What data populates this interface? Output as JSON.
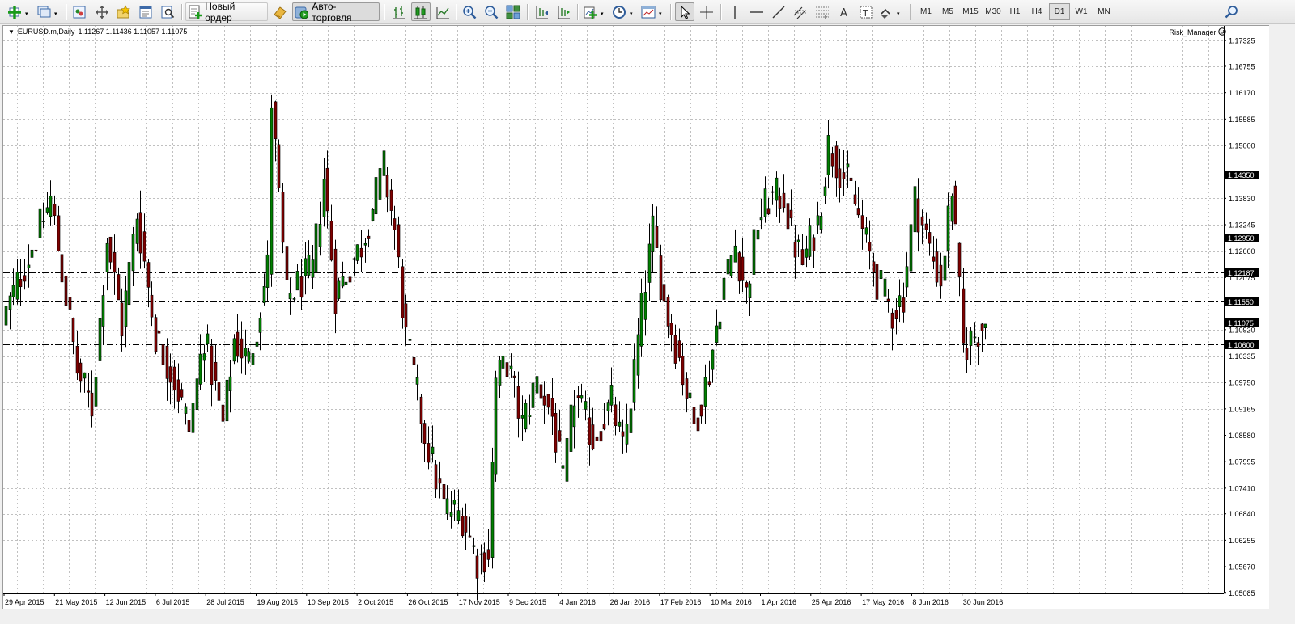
{
  "toolbar": {
    "new_order_label": "Новый ордер",
    "autotrading_label": "Авто-торговля",
    "timeframes": [
      "M1",
      "M5",
      "M15",
      "M30",
      "H1",
      "H4",
      "D1",
      "W1",
      "MN"
    ],
    "active_timeframe": "D1",
    "icons": [
      "new-chart-icon",
      "profiles-icon",
      "market-watch-icon",
      "navigator-icon",
      "favorites-icon",
      "data-window-icon",
      "strategy-tester-icon",
      "new-order-icon",
      "metaeditor-icon",
      "autotrading-icon",
      "bar-chart-icon",
      "candlesticks-icon",
      "line-chart-icon",
      "zoom-in-icon",
      "zoom-out-icon",
      "tile-windows-icon",
      "chart-shift-icon",
      "autoscroll-icon",
      "indicators-icon",
      "periods-icon",
      "templates-icon",
      "cursor-icon",
      "crosshair-icon",
      "vertical-line-icon",
      "horizontal-line-icon",
      "trendline-icon",
      "equidistant-channel-icon",
      "fibonacci-icon",
      "text-icon",
      "text-label-icon",
      "arrows-icon",
      "search-icon"
    ]
  },
  "chart": {
    "symbol": "EURUSD.m,Daily",
    "ohlc": "1.11267 1.11436 1.11057 1.11075",
    "indicator_label": "Risk_Manager",
    "colors": {
      "bull": "#008000",
      "bear": "#800000",
      "wick": "#000000",
      "grid": "#c0c0c0",
      "level_line": "#000000",
      "bid_line": "#c0c0c0",
      "background": "#ffffff"
    }
  },
  "chart_data": {
    "type": "candlestick",
    "title": "EURUSD.m,Daily",
    "ylim": [
      1.0508,
      1.1765
    ],
    "y_ticks": [
      "1.17325",
      "1.16755",
      "1.16170",
      "1.15585",
      "1.15000",
      "1.13830",
      "1.13245",
      "1.12660",
      "1.12075",
      "1.10920",
      "1.10335",
      "1.09750",
      "1.09165",
      "1.08580",
      "1.07995",
      "1.07410",
      "1.06840",
      "1.06255",
      "1.05670",
      "1.05085"
    ],
    "x_tick_labels": [
      "29 Apr 2015",
      "21 May 2015",
      "12 Jun 2015",
      "6 Jul 2015",
      "28 Jul 2015",
      "19 Aug 2015",
      "10 Sep 2015",
      "2 Oct 2015",
      "26 Oct 2015",
      "17 Nov 2015",
      "9 Dec 2015",
      "4 Jan 2016",
      "26 Jan 2016",
      "17 Feb 2016",
      "10 Mar 2016",
      "1 Apr 2016",
      "25 Apr 2016",
      "17 May 2016",
      "8 Jun 2016",
      "30 Jun 2016"
    ],
    "horizontal_levels": [
      {
        "label": "1.14350",
        "value": 1.1435
      },
      {
        "label": "1.12950",
        "value": 1.1295
      },
      {
        "label": "1.12187",
        "value": 1.12187
      },
      {
        "label": "1.11550",
        "value": 1.1155
      },
      {
        "label": "1.10600",
        "value": 1.106
      }
    ],
    "current_price": {
      "label": "1.11075",
      "value": 1.11075
    },
    "close_path": [
      [
        0,
        1.113
      ],
      [
        12,
        1.138
      ],
      [
        15,
        1.122
      ],
      [
        19,
        1.1
      ],
      [
        23,
        1.092
      ],
      [
        27,
        1.13
      ],
      [
        31,
        1.11
      ],
      [
        35,
        1.135
      ],
      [
        40,
        1.108
      ],
      [
        45,
        1.098
      ],
      [
        49,
        1.087
      ],
      [
        53,
        1.108
      ],
      [
        58,
        1.088
      ],
      [
        61,
        1.107
      ],
      [
        65,
        1.102
      ],
      [
        70,
        1.123
      ],
      [
        71,
        1.16
      ],
      [
        75,
        1.116
      ],
      [
        79,
        1.12
      ],
      [
        82,
        1.122
      ],
      [
        85,
        1.143
      ],
      [
        88,
        1.117
      ],
      [
        95,
        1.128
      ],
      [
        101,
        1.145
      ],
      [
        104,
        1.131
      ],
      [
        107,
        1.107
      ],
      [
        112,
        1.086
      ],
      [
        117,
        1.07
      ],
      [
        122,
        1.068
      ],
      [
        126,
        1.058
      ],
      [
        129,
        1.06
      ],
      [
        131,
        1.098
      ],
      [
        134,
        1.102
      ],
      [
        138,
        1.088
      ],
      [
        142,
        1.098
      ],
      [
        146,
        1.09
      ],
      [
        149,
        1.075
      ],
      [
        152,
        1.095
      ],
      [
        157,
        1.085
      ],
      [
        162,
        1.093
      ],
      [
        165,
        1.082
      ],
      [
        168,
        1.1
      ],
      [
        171,
        1.12
      ],
      [
        173,
        1.131
      ],
      [
        176,
        1.115
      ],
      [
        180,
        1.103
      ],
      [
        184,
        1.088
      ],
      [
        188,
        1.1
      ],
      [
        192,
        1.12
      ],
      [
        195,
        1.128
      ],
      [
        198,
        1.117
      ],
      [
        201,
        1.133
      ],
      [
        204,
        1.138
      ],
      [
        208,
        1.139
      ],
      [
        210,
        1.13
      ],
      [
        213,
        1.124
      ],
      [
        217,
        1.133
      ],
      [
        220,
        1.15
      ],
      [
        223,
        1.145
      ],
      [
        226,
        1.14
      ],
      [
        229,
        1.131
      ],
      [
        233,
        1.12
      ],
      [
        237,
        1.113
      ],
      [
        240,
        1.117
      ],
      [
        243,
        1.138
      ],
      [
        247,
        1.127
      ],
      [
        250,
        1.12
      ],
      [
        253,
        1.141
      ],
      [
        256,
        1.105
      ],
      [
        259,
        1.108
      ],
      [
        262,
        1.111
      ]
    ]
  },
  "bottom": {}
}
